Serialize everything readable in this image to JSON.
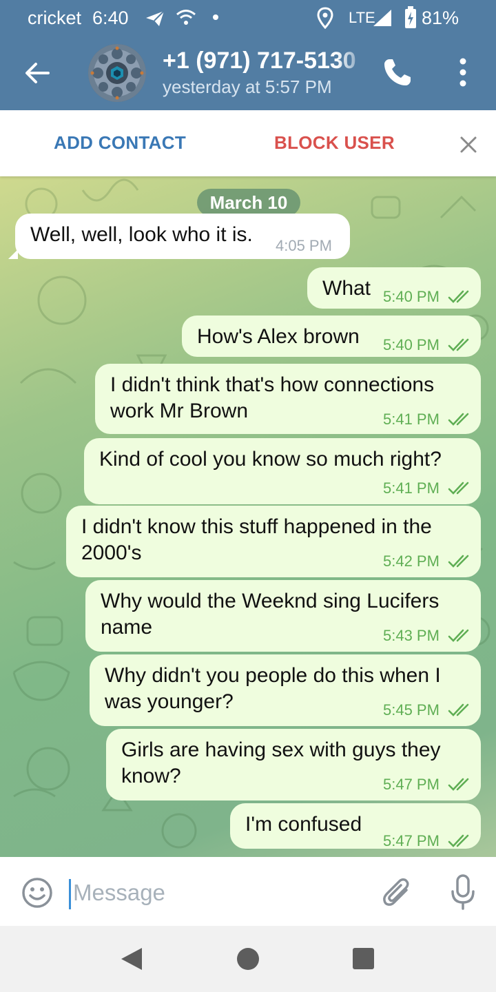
{
  "status_bar": {
    "carrier": "cricket",
    "time": "6:40",
    "network": "LTE",
    "battery": "81%"
  },
  "header": {
    "contact_name": "+1 (971) 717-5130",
    "last_seen": "yesterday at 5:57 PM"
  },
  "action_bar": {
    "add_contact": "ADD CONTACT",
    "block_user": "BLOCK USER"
  },
  "chat": {
    "date_label": "March 10",
    "messages": [
      {
        "direction": "in",
        "lines": [
          "Well, well, look who it is."
        ],
        "time": "4:05 PM"
      },
      {
        "direction": "out",
        "lines": [
          "What"
        ],
        "time": "5:40 PM",
        "status": "read"
      },
      {
        "direction": "out",
        "lines": [
          "How's Alex brown"
        ],
        "time": "5:40 PM",
        "status": "read"
      },
      {
        "direction": "out",
        "lines": [
          "I didn't think that's how connections",
          "work Mr Brown"
        ],
        "time": "5:41 PM",
        "status": "read"
      },
      {
        "direction": "out",
        "lines": [
          "Kind of cool you know so much right?"
        ],
        "time": "5:41 PM",
        "status": "read"
      },
      {
        "direction": "out",
        "lines": [
          "I didn't know this stuff happened in the",
          "2000's"
        ],
        "time": "5:42 PM",
        "status": "read"
      },
      {
        "direction": "out",
        "lines": [
          "Why would the Weeknd sing Lucifers",
          "name"
        ],
        "time": "5:43 PM",
        "status": "read"
      },
      {
        "direction": "out",
        "lines": [
          "Why didn't you people do this when I",
          "was younger?"
        ],
        "time": "5:45 PM",
        "status": "read"
      },
      {
        "direction": "out",
        "lines": [
          "Girls are having sex with guys they",
          "know?"
        ],
        "time": "5:47 PM",
        "status": "read"
      },
      {
        "direction": "out",
        "lines": [
          "I'm confused"
        ],
        "time": "5:47 PM",
        "status": "read"
      }
    ]
  },
  "composer": {
    "placeholder": "Message"
  },
  "colors": {
    "header": "#527da3",
    "outgoing_bubble": "#effdde",
    "incoming_bubble": "#ffffff",
    "read_tick": "#5fae54",
    "add_contact": "#3a78b5",
    "block_user": "#d9514d"
  },
  "icons": [
    "back-arrow-icon",
    "phone-icon",
    "more-vertical-icon",
    "close-icon",
    "emoji-icon",
    "attach-icon",
    "mic-icon",
    "telegram-send-icon",
    "wifi-icon",
    "location-icon",
    "signal-icon",
    "battery-icon"
  ]
}
